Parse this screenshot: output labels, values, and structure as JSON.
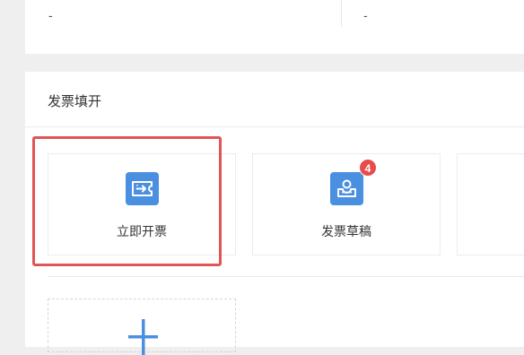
{
  "top_row": {
    "value_1": "-",
    "value_2": "-"
  },
  "section": {
    "title": "发票填开"
  },
  "cards": {
    "issue_invoice": {
      "label": "立即开票",
      "icon": "invoice-ticket-icon"
    },
    "invoice_draft": {
      "label": "发票草稿",
      "icon": "inbox-tray-icon",
      "badge": "4"
    }
  },
  "add": {
    "icon": "plus-icon"
  },
  "colors": {
    "icon_bg": "#4a8fe0",
    "badge": "#e84b4b",
    "highlight": "#e05656",
    "plus": "#4a8fe0"
  }
}
